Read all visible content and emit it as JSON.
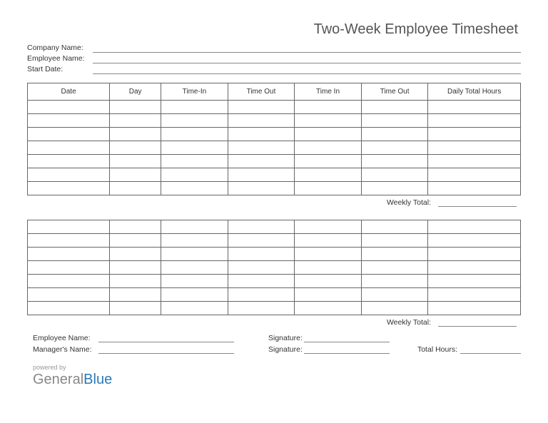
{
  "title": "Two-Week Employee Timesheet",
  "header_fields": {
    "company_name_label": "Company Name:",
    "employee_name_label": "Employee Name:",
    "start_date_label": "Start Date:"
  },
  "columns": {
    "date": "Date",
    "day": "Day",
    "time_in_1": "Time-In",
    "time_out_1": "Time Out",
    "time_in_2": "Time In",
    "time_out_2": "Time Out",
    "daily_total": "Daily Total Hours"
  },
  "weekly_total_label": "Weekly Total:",
  "week1_rows": 7,
  "week2_rows": 7,
  "signatures": {
    "employee_name_label": "Employee Name:",
    "managers_name_label": "Manager's Name:",
    "signature_label": "Signature:",
    "total_hours_label": "Total Hours:"
  },
  "footer": {
    "powered_by": "powered by",
    "logo_part1": "General",
    "logo_part2": "Blue"
  }
}
